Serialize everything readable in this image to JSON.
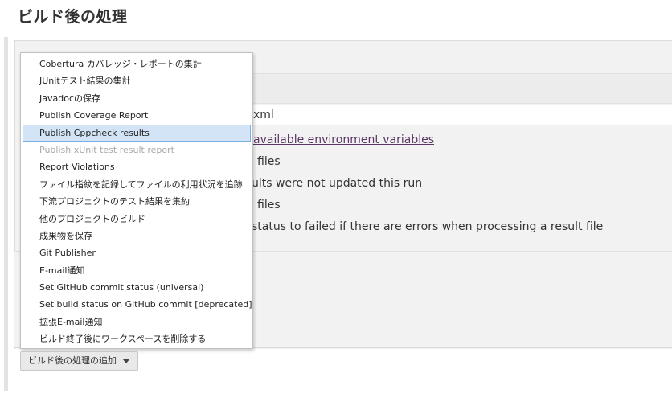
{
  "section": {
    "title": "ビルド後の処理"
  },
  "panel": {
    "input_value": "xml",
    "env_link": "available environment variables",
    "lines": [
      "files",
      "ults were not updated this run",
      "files",
      "status to failed if there are errors when processing a result file"
    ]
  },
  "menu": {
    "items": [
      {
        "label": "Cobertura カバレッジ・レポートの集計",
        "state": "normal"
      },
      {
        "label": "JUnitテスト結果の集計",
        "state": "normal"
      },
      {
        "label": "Javadocの保存",
        "state": "normal"
      },
      {
        "label": "Publish Coverage Report",
        "state": "normal"
      },
      {
        "label": "Publish Cppcheck results",
        "state": "selected"
      },
      {
        "label": "Publish xUnit test result report",
        "state": "disabled"
      },
      {
        "label": "Report Violations",
        "state": "normal"
      },
      {
        "label": "ファイル指紋を記録してファイルの利用状況を追跡",
        "state": "normal"
      },
      {
        "label": "下流プロジェクトのテスト結果を集約",
        "state": "normal"
      },
      {
        "label": "他のプロジェクトのビルド",
        "state": "normal"
      },
      {
        "label": "成果物を保存",
        "state": "normal"
      },
      {
        "label": "Git Publisher",
        "state": "normal"
      },
      {
        "label": "E-mail通知",
        "state": "normal"
      },
      {
        "label": "Set GitHub commit status (universal)",
        "state": "normal"
      },
      {
        "label": "Set build status on GitHub commit [deprecated]",
        "state": "normal"
      },
      {
        "label": "拡張E-mail通知",
        "state": "normal"
      },
      {
        "label": "ビルド終了後にワークスペースを削除する",
        "state": "normal"
      }
    ]
  },
  "add_button": {
    "label": "ビルド後の処理の追加",
    "icon": "caret-down-icon"
  }
}
